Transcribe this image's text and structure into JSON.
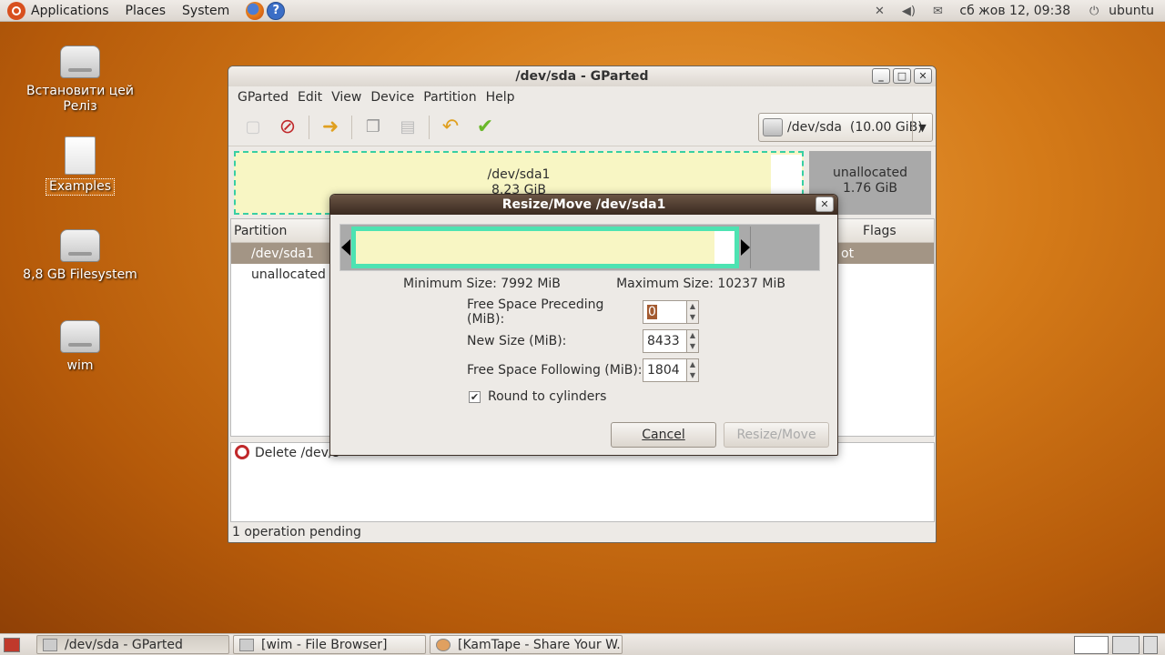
{
  "top_panel": {
    "menus": [
      "Applications",
      "Places",
      "System"
    ],
    "help_glyph": "?",
    "clock": "сб жов 12, 09:38",
    "user": "ubuntu"
  },
  "desktop_icons": [
    {
      "label": "Встановити цей Реліз",
      "icon": "install-icon"
    },
    {
      "label": "Examples",
      "icon": "document-icon"
    },
    {
      "label": "8,8 GB Filesystem",
      "icon": "drive-icon"
    },
    {
      "label": "wim",
      "icon": "drive-icon"
    }
  ],
  "gparted": {
    "title": "/dev/sda - GParted",
    "menus": [
      "GParted",
      "Edit",
      "View",
      "Device",
      "Partition",
      "Help"
    ],
    "device_select": "/dev/sda  (10.00 GiB)",
    "disk_map": {
      "sda1": {
        "name": "/dev/sda1",
        "size": "8.23 GiB"
      },
      "unallocated": {
        "name": "unallocated",
        "size": "1.76 GiB"
      }
    },
    "table": {
      "headers": {
        "partition": "Partition",
        "flags": "Flags"
      },
      "rows": [
        {
          "partition": "/dev/sda1",
          "flags_visible": "ot"
        },
        {
          "partition": "unallocated",
          "flags_visible": ""
        }
      ]
    },
    "pending_op": "Delete /dev/s",
    "status": "1 operation pending"
  },
  "dialog": {
    "title": "Resize/Move /dev/sda1",
    "min_size": "Minimum Size: 7992 MiB",
    "max_size": "Maximum Size: 10237 MiB",
    "fields": [
      {
        "label": "Free Space Preceding (MiB):",
        "value": "0"
      },
      {
        "label": "New Size (MiB):",
        "value": "8433"
      },
      {
        "label": "Free Space Following (MiB):",
        "value": "1804"
      }
    ],
    "round_label": "Round to cylinders",
    "round_checked": true,
    "cancel": "Cancel",
    "resize": "Resize/Move"
  },
  "taskbar": {
    "tasks": [
      "/dev/sda - GParted",
      "[wim - File Browser]",
      "[KamTape - Share Your W..."
    ]
  },
  "colors": {
    "partition_fill": "#f8f6c4",
    "partition_border": "#4de3b2",
    "unallocated": "#a9a9a9",
    "selected_row": "#a39585",
    "dialog_title": "#3a2a20"
  }
}
